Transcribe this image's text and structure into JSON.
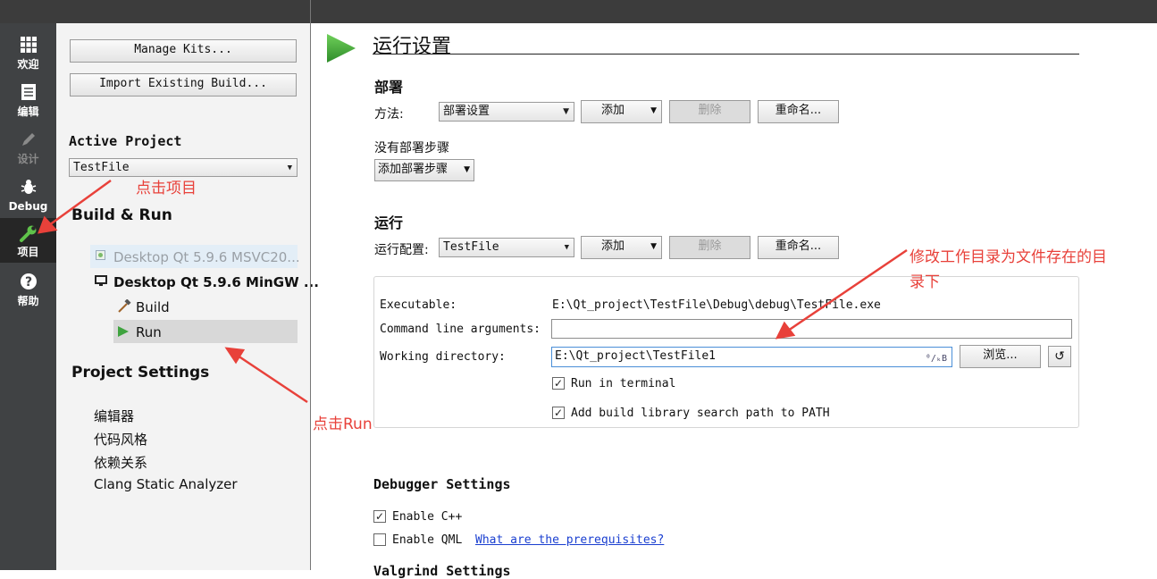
{
  "modes": [
    {
      "label": "欢迎",
      "icon": "grid-icon"
    },
    {
      "label": "编辑",
      "icon": "document-icon"
    },
    {
      "label": "设计",
      "icon": "pencil-icon"
    },
    {
      "label": "Debug",
      "icon": "bug-icon"
    },
    {
      "label": "项目",
      "icon": "wrench-icon"
    },
    {
      "label": "帮助",
      "icon": "help-icon"
    }
  ],
  "sidebar": {
    "manage_kits": "Manage Kits...",
    "import_build": "Import Existing Build...",
    "active_project_heading": "Active Project",
    "active_project_value": "TestFile",
    "build_run_heading": "Build & Run",
    "kits": [
      {
        "label": "Desktop Qt 5.9.6 MSVC20..."
      },
      {
        "label": "Desktop Qt 5.9.6 MinGW ..."
      }
    ],
    "build_label": "Build",
    "run_label": "Run",
    "project_settings_heading": "Project Settings",
    "settings_items": [
      "编辑器",
      "代码风格",
      "依赖关系",
      "Clang Static Analyzer"
    ]
  },
  "main": {
    "title": "运行设置",
    "deploy": {
      "heading": "部署",
      "method_label": "方法:",
      "method_value": "部署设置",
      "add": "添加",
      "remove": "删除",
      "rename": "重命名...",
      "no_steps": "没有部署步骤",
      "add_step": "添加部署步骤"
    },
    "run": {
      "heading": "运行",
      "config_label": "运行配置:",
      "config_value": "TestFile",
      "add": "添加",
      "remove": "删除",
      "rename": "重命名...",
      "executable_label": "Executable:",
      "executable_value": "E:\\Qt_project\\TestFile\\Debug\\debug\\TestFile.exe",
      "args_label": "Command line arguments:",
      "args_value": "",
      "workdir_label": "Working directory:",
      "workdir_value": "E:\\Qt_project\\TestFile1",
      "browse": "浏览...",
      "run_in_terminal": "Run in terminal",
      "add_library_path": "Add build library search path to PATH"
    },
    "debugger": {
      "heading": "Debugger Settings",
      "enable_cpp": "Enable C++",
      "enable_qml": "Enable QML",
      "prereq_link": "What are the prerequisites?",
      "cut_heading": "Valgrind Settings"
    }
  },
  "annotations": {
    "click_project": "点击项目",
    "click_run": "点击Run",
    "workdir_note_1": "修改工作目录为文件存在的目",
    "workdir_note_2": "录下"
  },
  "colors": {
    "accent_red": "#e8413a",
    "play_green": "#3fa33f",
    "mode_bar": "#404244"
  }
}
